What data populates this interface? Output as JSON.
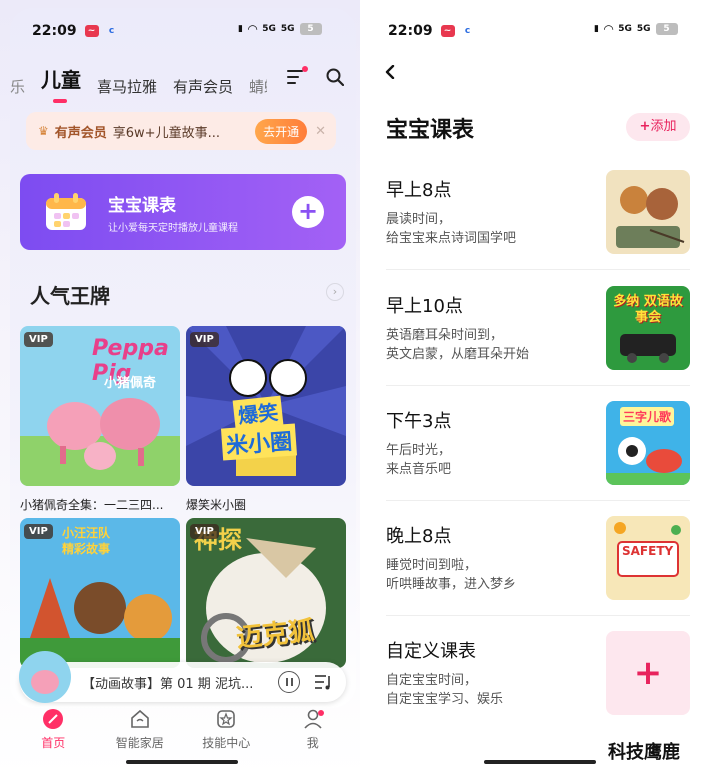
{
  "left": {
    "status": {
      "time": "22:09",
      "battery": "5",
      "net_a": "5G",
      "net_b": "5G"
    },
    "tabs": {
      "partial_left": "乐",
      "active": "儿童",
      "t2": "喜马拉雅",
      "t3": "有声会员",
      "partial_right": "蜻蜓"
    },
    "vip_banner": {
      "title": "有声会员",
      "desc": "享6w+儿童故事...",
      "button": "去开通"
    },
    "schedule_card": {
      "title": "宝宝课表",
      "subtitle": "让小爱每天定时播放儿童课程"
    },
    "section": {
      "title": "人气王牌"
    },
    "tiles": [
      {
        "vip": "VIP",
        "caption": "小猪佩奇全集：一二三四...",
        "art1": "Peppa Pig",
        "art2": "小猪佩奇"
      },
      {
        "vip": "VIP",
        "caption": "爆笑米小圈",
        "art1": "爆笑",
        "art2": "米小圈"
      },
      {
        "vip": "VIP",
        "art1": "小汪汪队",
        "art2": "精彩故事"
      },
      {
        "vip": "VIP",
        "art1": "迈克狐",
        "art2": "神探"
      }
    ],
    "player": {
      "title": "【动画故事】第 01 期 泥坑..."
    },
    "nav": [
      {
        "label": "首页"
      },
      {
        "label": "智能家居"
      },
      {
        "label": "技能中心"
      },
      {
        "label": "我"
      }
    ]
  },
  "right": {
    "status": {
      "time": "22:09",
      "battery": "5",
      "net_a": "5G",
      "net_b": "5G"
    },
    "title": "宝宝课表",
    "add_button": "添加",
    "slots": [
      {
        "time": "早上8点",
        "desc1": "晨读时间，",
        "desc2": "给宝宝来点诗词国学吧"
      },
      {
        "time": "早上10点",
        "desc1": "英语磨耳朵时间到，",
        "desc2": "英文启蒙，从磨耳朵开始",
        "art": "多纳 双语故事会"
      },
      {
        "time": "下午3点",
        "desc1": "午后时光，",
        "desc2": "来点音乐吧",
        "art": "三字儿歌"
      },
      {
        "time": "晚上8点",
        "desc1": "睡觉时间到啦，",
        "desc2": "听哄睡故事，进入梦乡",
        "art": "SAFETY"
      },
      {
        "time": "自定义课表",
        "desc1": "自定宝宝时间，",
        "desc2": "自定宝宝学习、娱乐"
      }
    ]
  },
  "watermark": "科技鹰鹿",
  "colors": {
    "accent": "#ff2f66",
    "purple": "#8a51f3",
    "pink_bg": "#fde7ee"
  }
}
